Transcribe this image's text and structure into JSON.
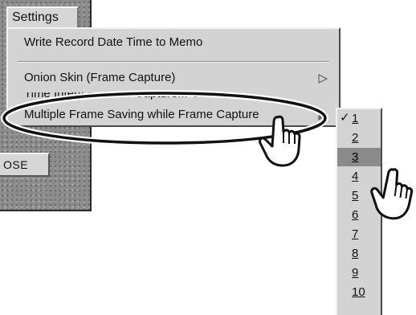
{
  "menubar": {
    "settings_label": "Settings"
  },
  "close_button": {
    "label": "OSE"
  },
  "menu": {
    "items": [
      {
        "label": "Write Record Date Time to Memo"
      },
      {
        "label": "Onion Skin (Frame Capture)"
      },
      {
        "label": "Time Interval Frame Capture... OFF"
      },
      {
        "label": "Multiple Frame Saving while Frame Capture"
      }
    ]
  },
  "submenu": {
    "checked_value": "1",
    "selected_value": "3",
    "items": [
      "1",
      "2",
      "3",
      "4",
      "5",
      "6",
      "7",
      "8",
      "9",
      "10"
    ]
  },
  "icons": {
    "submenu_arrow": "triangle-right-icon",
    "check": "checkmark-icon",
    "pointer": "hand-pointer-icon"
  },
  "colors": {
    "menu_bg": "#d3d3d3",
    "selected_bg": "#8a8a8a",
    "panel_texture": "#8c8c8c"
  }
}
